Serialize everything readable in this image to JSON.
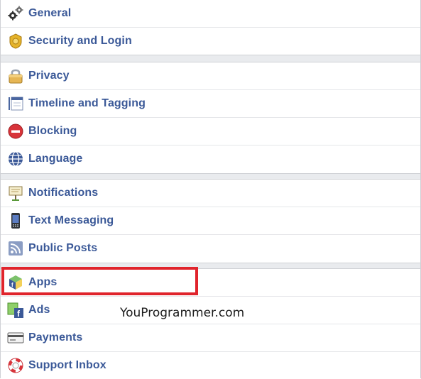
{
  "settings_menu": {
    "groups": [
      {
        "items": [
          {
            "label": "General",
            "icon": "gears-icon"
          },
          {
            "label": "Security and Login",
            "icon": "security-badge-icon"
          }
        ]
      },
      {
        "items": [
          {
            "label": "Privacy",
            "icon": "padlock-icon"
          },
          {
            "label": "Timeline and Tagging",
            "icon": "timeline-icon"
          },
          {
            "label": "Blocking",
            "icon": "block-icon"
          },
          {
            "label": "Language",
            "icon": "globe-icon"
          }
        ]
      },
      {
        "items": [
          {
            "label": "Notifications",
            "icon": "notification-sign-icon"
          },
          {
            "label": "Text Messaging",
            "icon": "phone-icon"
          },
          {
            "label": "Public Posts",
            "icon": "rss-feed-icon"
          }
        ]
      },
      {
        "items": [
          {
            "label": "Apps",
            "icon": "apps-cube-icon"
          },
          {
            "label": "Ads",
            "icon": "ads-icon"
          },
          {
            "label": "Payments",
            "icon": "credit-card-icon"
          },
          {
            "label": "Support Inbox",
            "icon": "lifebuoy-icon"
          }
        ]
      }
    ]
  },
  "highlight": {
    "target": "Apps",
    "color": "#e0242c"
  },
  "watermark": {
    "text": "YouProgrammer.com"
  },
  "colors": {
    "link": "#3b5998",
    "separator": "#e9ebee",
    "border": "#cfd1d5"
  }
}
